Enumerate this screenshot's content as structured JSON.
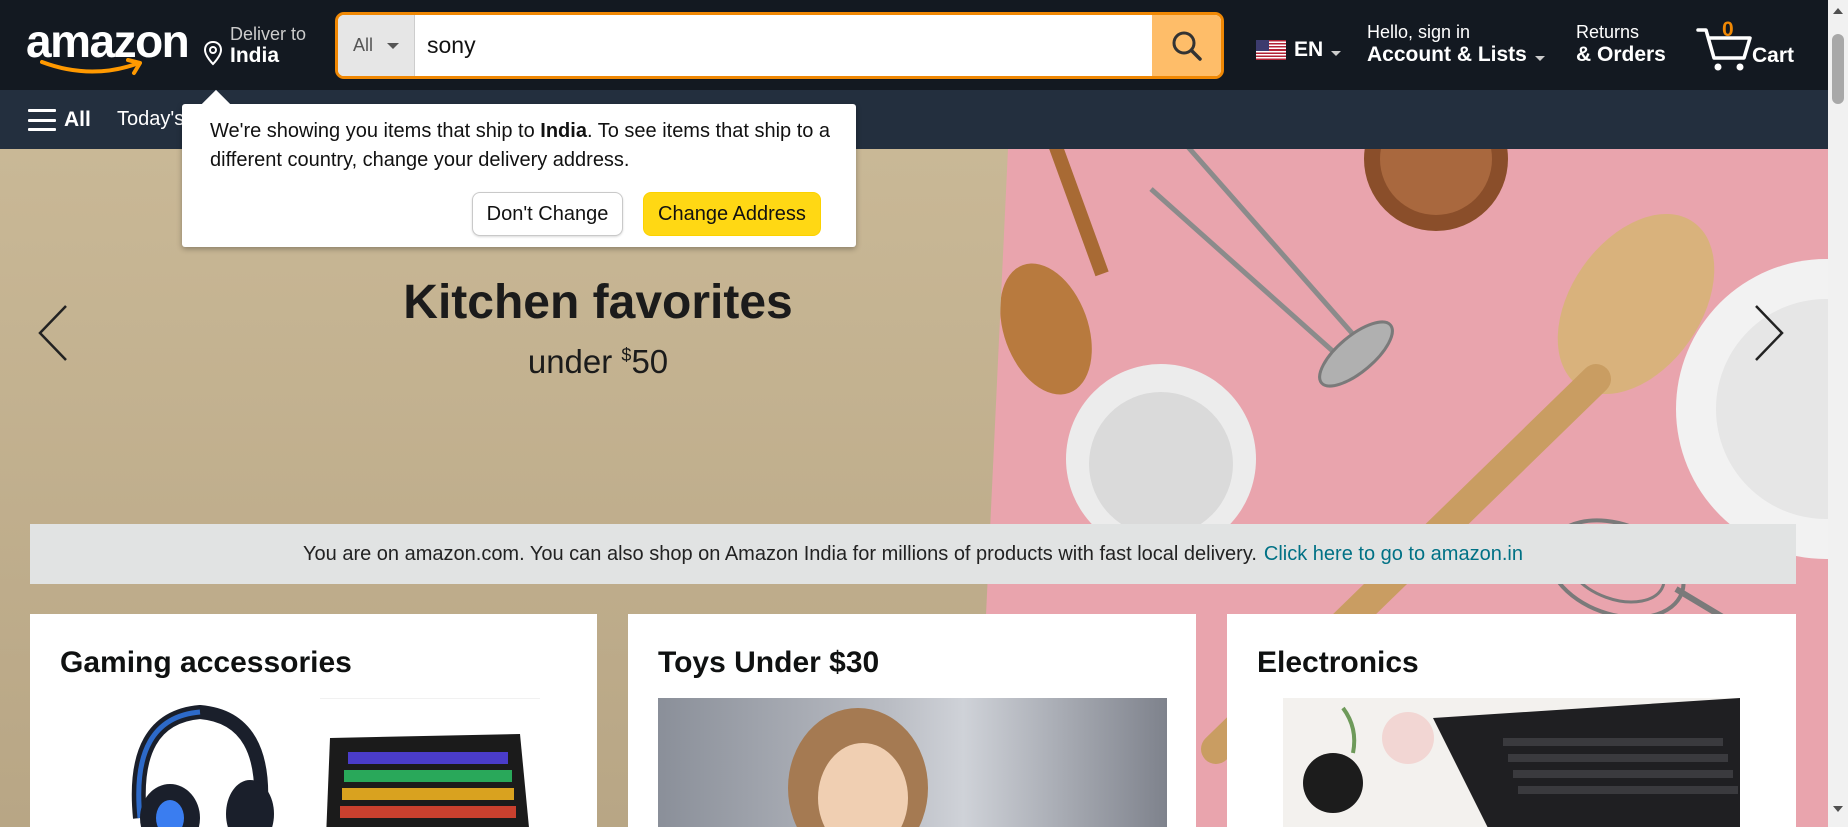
{
  "header": {
    "logo_text": "amazon",
    "deliver": {
      "line1": "Deliver to",
      "line2": "India"
    },
    "search": {
      "category": "All",
      "query": "sony"
    },
    "language": {
      "code": "EN"
    },
    "account": {
      "greeting": "Hello, sign in",
      "label": "Account & Lists"
    },
    "returns": {
      "line1": "Returns",
      "line2": "& Orders"
    },
    "cart": {
      "count": "0",
      "label": "Cart"
    }
  },
  "subnav": {
    "menu_label": "All",
    "item1": "Today's"
  },
  "hero": {
    "title": "Kitchen favorites",
    "subtitle_prefix": "under ",
    "subtitle_currency": "$",
    "subtitle_amount": "50"
  },
  "info_bar": {
    "text": "You are on amazon.com. You can also shop on Amazon India for millions of products with fast local delivery.",
    "link": "Click here to go to amazon.in"
  },
  "cards": [
    {
      "title": "Gaming accessories"
    },
    {
      "title": "Toys Under $30"
    },
    {
      "title": "Electronics"
    }
  ],
  "popover": {
    "text_before": "We're showing you items that ship to ",
    "country": "India",
    "text_after": ". To see items that ship to a different country, change your delivery address.",
    "dont_change": "Don't Change",
    "change_address": "Change Address"
  },
  "colors": {
    "nav_dark": "#131921",
    "nav_sub": "#232f3e",
    "accent_orange": "#f08804",
    "search_button": "#febd69",
    "primary_button": "#ffd814",
    "link": "#007185"
  }
}
